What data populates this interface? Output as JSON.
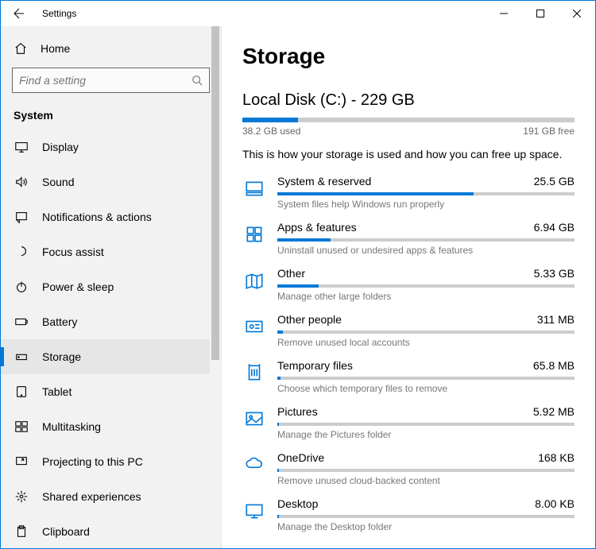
{
  "window": {
    "title": "Settings"
  },
  "sidebar": {
    "home_label": "Home",
    "search_placeholder": "Find a setting",
    "section_label": "System",
    "items": [
      {
        "label": "Display"
      },
      {
        "label": "Sound"
      },
      {
        "label": "Notifications & actions"
      },
      {
        "label": "Focus assist"
      },
      {
        "label": "Power & sleep"
      },
      {
        "label": "Battery"
      },
      {
        "label": "Storage"
      },
      {
        "label": "Tablet"
      },
      {
        "label": "Multitasking"
      },
      {
        "label": "Projecting to this PC"
      },
      {
        "label": "Shared experiences"
      },
      {
        "label": "Clipboard"
      }
    ]
  },
  "page": {
    "title": "Storage",
    "disk_label": "Local Disk (C:) - 229 GB",
    "used_label": "38.2 GB used",
    "free_label": "191 GB free",
    "used_pct": 16.7,
    "hint": "This is how your storage is used and how you can free up space.",
    "categories": [
      {
        "name": "System & reserved",
        "size": "25.5 GB",
        "desc": "System files help Windows run properly",
        "pct": 66
      },
      {
        "name": "Apps & features",
        "size": "6.94 GB",
        "desc": "Uninstall unused or undesired apps & features",
        "pct": 18
      },
      {
        "name": "Other",
        "size": "5.33 GB",
        "desc": "Manage other large folders",
        "pct": 14
      },
      {
        "name": "Other people",
        "size": "311 MB",
        "desc": "Remove unused local accounts",
        "pct": 2
      },
      {
        "name": "Temporary files",
        "size": "65.8 MB",
        "desc": "Choose which temporary files to remove",
        "pct": 1
      },
      {
        "name": "Pictures",
        "size": "5.92 MB",
        "desc": "Manage the Pictures folder",
        "pct": 0.5
      },
      {
        "name": "OneDrive",
        "size": "168 KB",
        "desc": "Remove unused cloud-backed content",
        "pct": 0.5
      },
      {
        "name": "Desktop",
        "size": "8.00 KB",
        "desc": "Manage the Desktop folder",
        "pct": 0.5
      }
    ]
  },
  "colors": {
    "accent": "#0078d7"
  }
}
